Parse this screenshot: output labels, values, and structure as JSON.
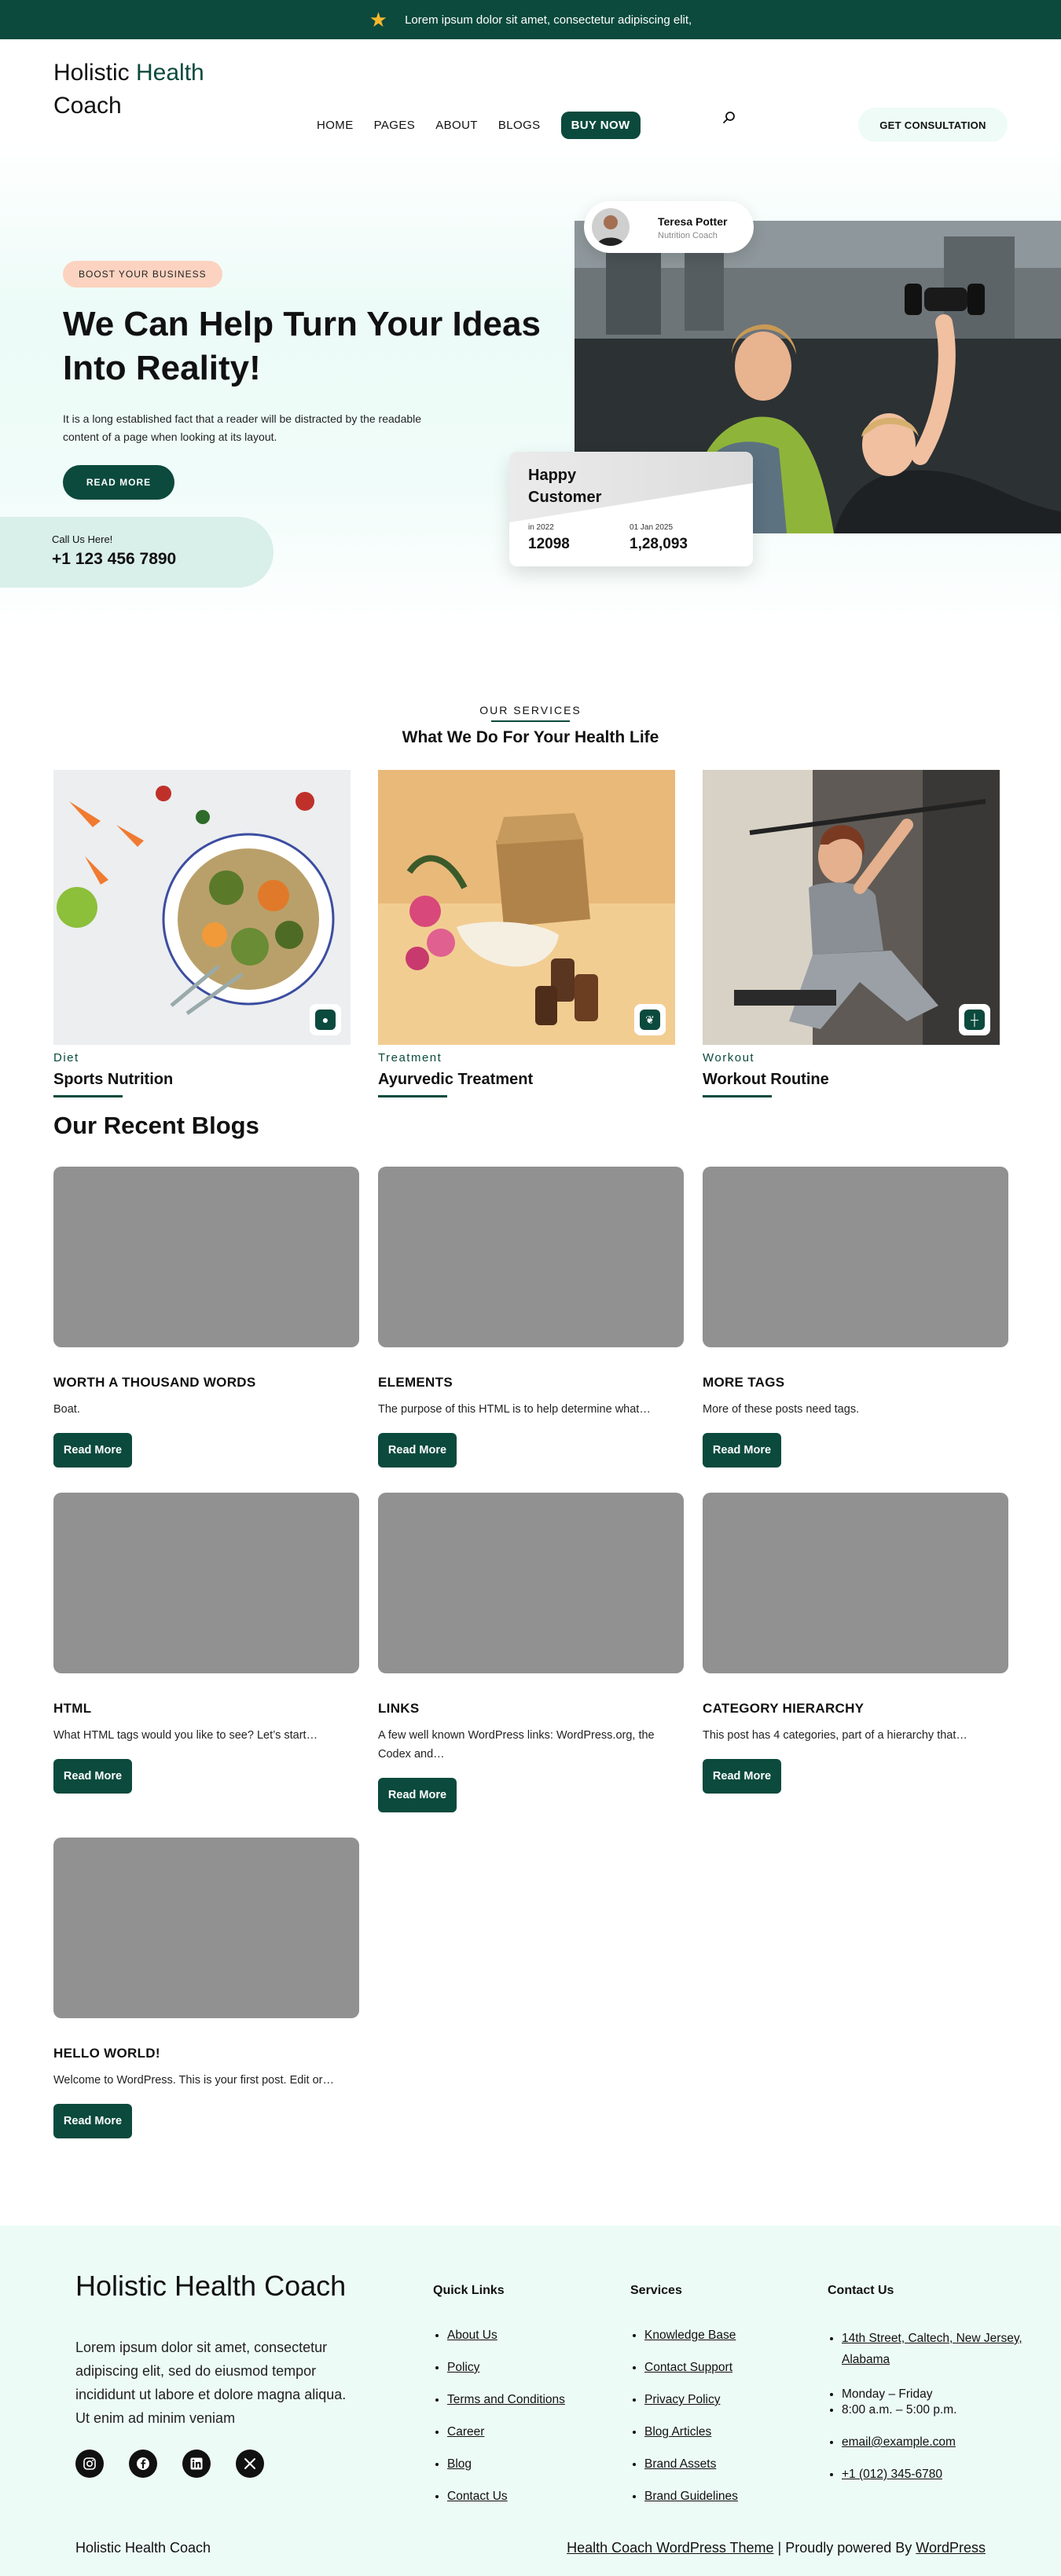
{
  "topbar": {
    "icon": "star-icon",
    "text": "Lorem ipsum dolor sit amet, consectetur adipiscing elit,"
  },
  "header": {
    "logo_part1": "Holistic ",
    "logo_accent": "Health",
    "logo_part2": "Coach",
    "nav": [
      "HOME",
      "PAGES",
      "ABOUT",
      "BLOGS"
    ],
    "buy_label": "BUY NOW",
    "consult_label": "GET CONSULTATION"
  },
  "hero": {
    "badge": "BOOST YOUR BUSINESS",
    "title": "We Can Help Turn Your Ideas Into Reality!",
    "text": "It is a long established fact that a reader will be distracted by the readable content of a page when looking at its layout.",
    "button": "READ MORE",
    "call_label": "Call Us Here!",
    "call_phone": "+1 123 456 7890",
    "profile_name": "Teresa Potter",
    "profile_role": "Nutrition Coach",
    "happy_title": "Happy Customer",
    "stats": [
      {
        "label": "in 2022",
        "value": "12098"
      },
      {
        "label": "01 Jan 2025",
        "value": "1,28,093"
      }
    ]
  },
  "services": {
    "kicker": "OUR SERVICES",
    "title": "What We Do For Your Health Life",
    "items": [
      {
        "category": "Diet",
        "name": "Sports Nutrition",
        "icon": "apple-icon"
      },
      {
        "category": "Treatment",
        "name": "Ayurvedic Treatment",
        "icon": "leaf-icon"
      },
      {
        "category": "Workout",
        "name": "Workout Routine",
        "icon": "dumbbell-icon"
      }
    ]
  },
  "blogs": {
    "title": "Our Recent Blogs",
    "button": "Read More",
    "posts": [
      {
        "title": "WORTH A THOUSAND WORDS",
        "excerpt": "Boat."
      },
      {
        "title": "ELEMENTS",
        "excerpt": "The purpose of this HTML is to help determine what…"
      },
      {
        "title": "MORE TAGS",
        "excerpt": "More of these posts need tags."
      },
      {
        "title": "HTML",
        "excerpt": "What HTML tags would you like to see? Let’s start…"
      },
      {
        "title": "LINKS",
        "excerpt": "A few well known WordPress links: WordPress.org, the Codex and…"
      },
      {
        "title": "CATEGORY HIERARCHY",
        "excerpt": "This post has 4 categories, part of a hierarchy that…"
      },
      {
        "title": "HELLO WORLD!",
        "excerpt": "Welcome to WordPress. This is your first post. Edit or…"
      }
    ]
  },
  "footer": {
    "logo": "Holistic Health Coach",
    "about": "Lorem ipsum dolor sit amet, consectetur adipiscing elit, sed do eiusmod tempor incididunt ut labore et dolore magna aliqua. Ut enim ad minim veniam",
    "socials": [
      "instagram-icon",
      "facebook-icon",
      "linkedin-icon",
      "x-icon"
    ],
    "quick_links": {
      "heading": "Quick Links",
      "items": [
        "About Us",
        "Policy",
        "Terms and Conditions",
        "Career",
        "Blog",
        "Contact Us"
      ]
    },
    "services": {
      "heading": "Services",
      "items": [
        "Knowledge Base",
        "Contact Support",
        "Privacy Policy",
        "Blog Articles",
        "Brand Assets",
        "Brand Guidelines"
      ]
    },
    "contact": {
      "heading": "Contact Us",
      "address": "14th Street, Caltech, New Jersey, Alabama",
      "hours_days": "Monday – Friday",
      "hours_time": "8:00 a.m. – 5:00 p.m.",
      "email": "email@example.com",
      "phone": "+1 (012) 345-6780"
    },
    "bottom_left": "Holistic Health Coach",
    "bottom_theme": "Health Coach WordPress Theme",
    "bottom_sep": " | Proudly powered By ",
    "bottom_wp": "WordPress"
  },
  "colors": {
    "brand": "#0b4a3d",
    "star": "#f5b82e",
    "badge": "#fcd3c0",
    "hero_bg": "#ecfbf7",
    "thumb": "#919191"
  }
}
